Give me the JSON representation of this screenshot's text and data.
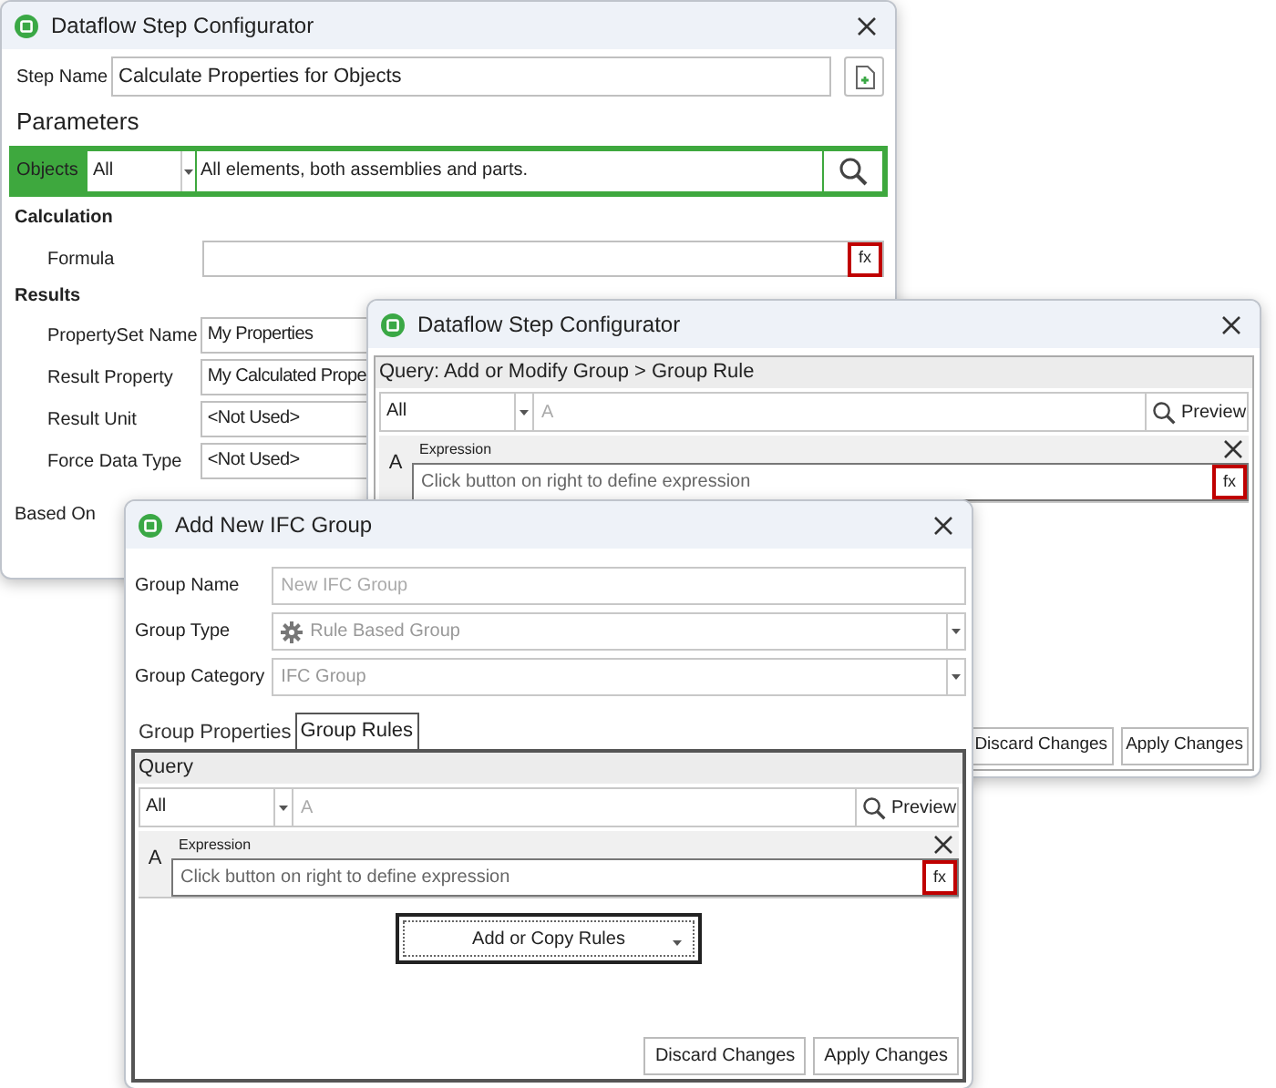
{
  "windows": [
    {
      "kind": "configurator",
      "title": "Dataflow Step Configurator",
      "step_name": {
        "label": "Step Name",
        "value": "Calculate Properties for Objects"
      },
      "section": "Parameters",
      "objects": {
        "label": "Objects",
        "scope": "All",
        "description": "All elements, both assemblies and parts."
      },
      "calculation": {
        "heading": "Calculation",
        "formula_label": "Formula",
        "button": "fx"
      },
      "results": {
        "heading": "Results",
        "fields": [
          {
            "label": "PropertySet Name",
            "value": "My Properties"
          },
          {
            "label": "Result Property",
            "value": "My Calculated Prope"
          },
          {
            "label": "Result Unit",
            "value": "<Not Used>"
          },
          {
            "label": "Force Data Type",
            "value": "<Not Used>"
          }
        ]
      },
      "based_on": {
        "label": "Based On"
      }
    },
    {
      "kind": "query",
      "title": "Dataflow Step Configurator",
      "query": {
        "header": "Query: Add or Modify Group > Group Rule",
        "scope": "All",
        "placeholder": "A",
        "preview": "Preview",
        "rule_letter": "A",
        "expression_label": "Expression",
        "expression_placeholder": "Click button on right to define expression",
        "button": "fx"
      },
      "buttons": [
        "Discard Changes",
        "Apply Changes"
      ]
    },
    {
      "kind": "group",
      "title": "Add New IFC Group",
      "fields": [
        {
          "kind": "text",
          "label": "Group Name",
          "placeholder": "New IFC Group"
        },
        {
          "kind": "gear_select",
          "label": "Group Type",
          "value": "Rule Based Group",
          "disabled": true
        },
        {
          "kind": "select",
          "label": "Group Category",
          "value": "IFC Group",
          "disabled": true
        }
      ],
      "tabs": [
        {
          "label": "Group Properties",
          "selected": false
        },
        {
          "label": "Group Rules",
          "selected": true
        }
      ],
      "query": {
        "header": "Query",
        "scope": "All",
        "placeholder": "A",
        "preview": "Preview",
        "rule_letter": "A",
        "expression_label": "Expression",
        "expression_placeholder": "Click button on right to define expression",
        "button": "fx"
      },
      "add_button": "Add or Copy Rules",
      "buttons": [
        "Discard Changes",
        "Apply Changes"
      ]
    }
  ]
}
